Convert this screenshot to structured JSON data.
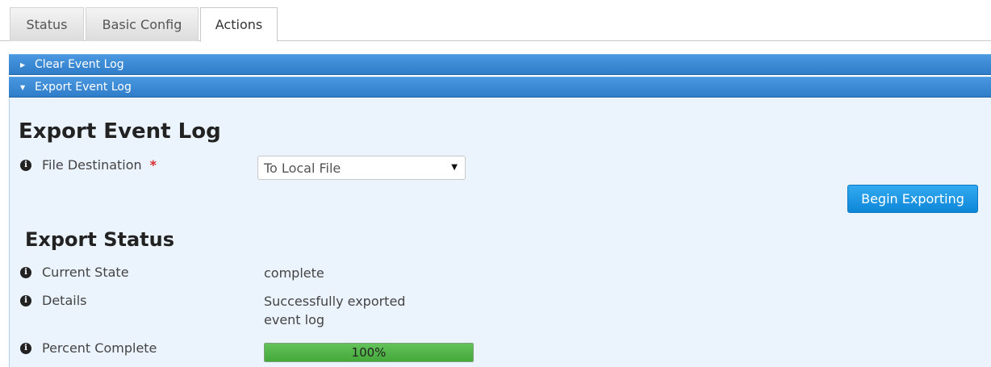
{
  "tabs": [
    {
      "label": "Status",
      "active": false
    },
    {
      "label": "Basic Config",
      "active": false
    },
    {
      "label": "Actions",
      "active": true
    }
  ],
  "accordion": [
    {
      "label": "Clear Event Log",
      "expanded": false
    },
    {
      "label": "Export Event Log",
      "expanded": true
    }
  ],
  "export": {
    "title": "Export Event Log",
    "file_destination_label": "File Destination",
    "required_mark": "*",
    "file_destination_value": "To Local File",
    "begin_button": "Begin Exporting"
  },
  "status": {
    "title": "Export Status",
    "current_state_label": "Current State",
    "current_state_value": "complete",
    "details_label": "Details",
    "details_value_line1": "Successfully exported",
    "details_value_line2": "event log",
    "percent_label": "Percent Complete",
    "percent_value": 1.0,
    "percent_text": "100%"
  },
  "icons": {
    "info": "info-circle-icon",
    "collapsed": "triangle-right-icon",
    "expanded": "triangle-down-icon",
    "dropdown": "caret-down-icon"
  },
  "colors": {
    "accordion_header": "#2f7cc9",
    "panel_bg": "#ebf3fc",
    "primary_button": "#0d86d8",
    "progress_fill": "#44a83a",
    "required": "#d9292b"
  }
}
